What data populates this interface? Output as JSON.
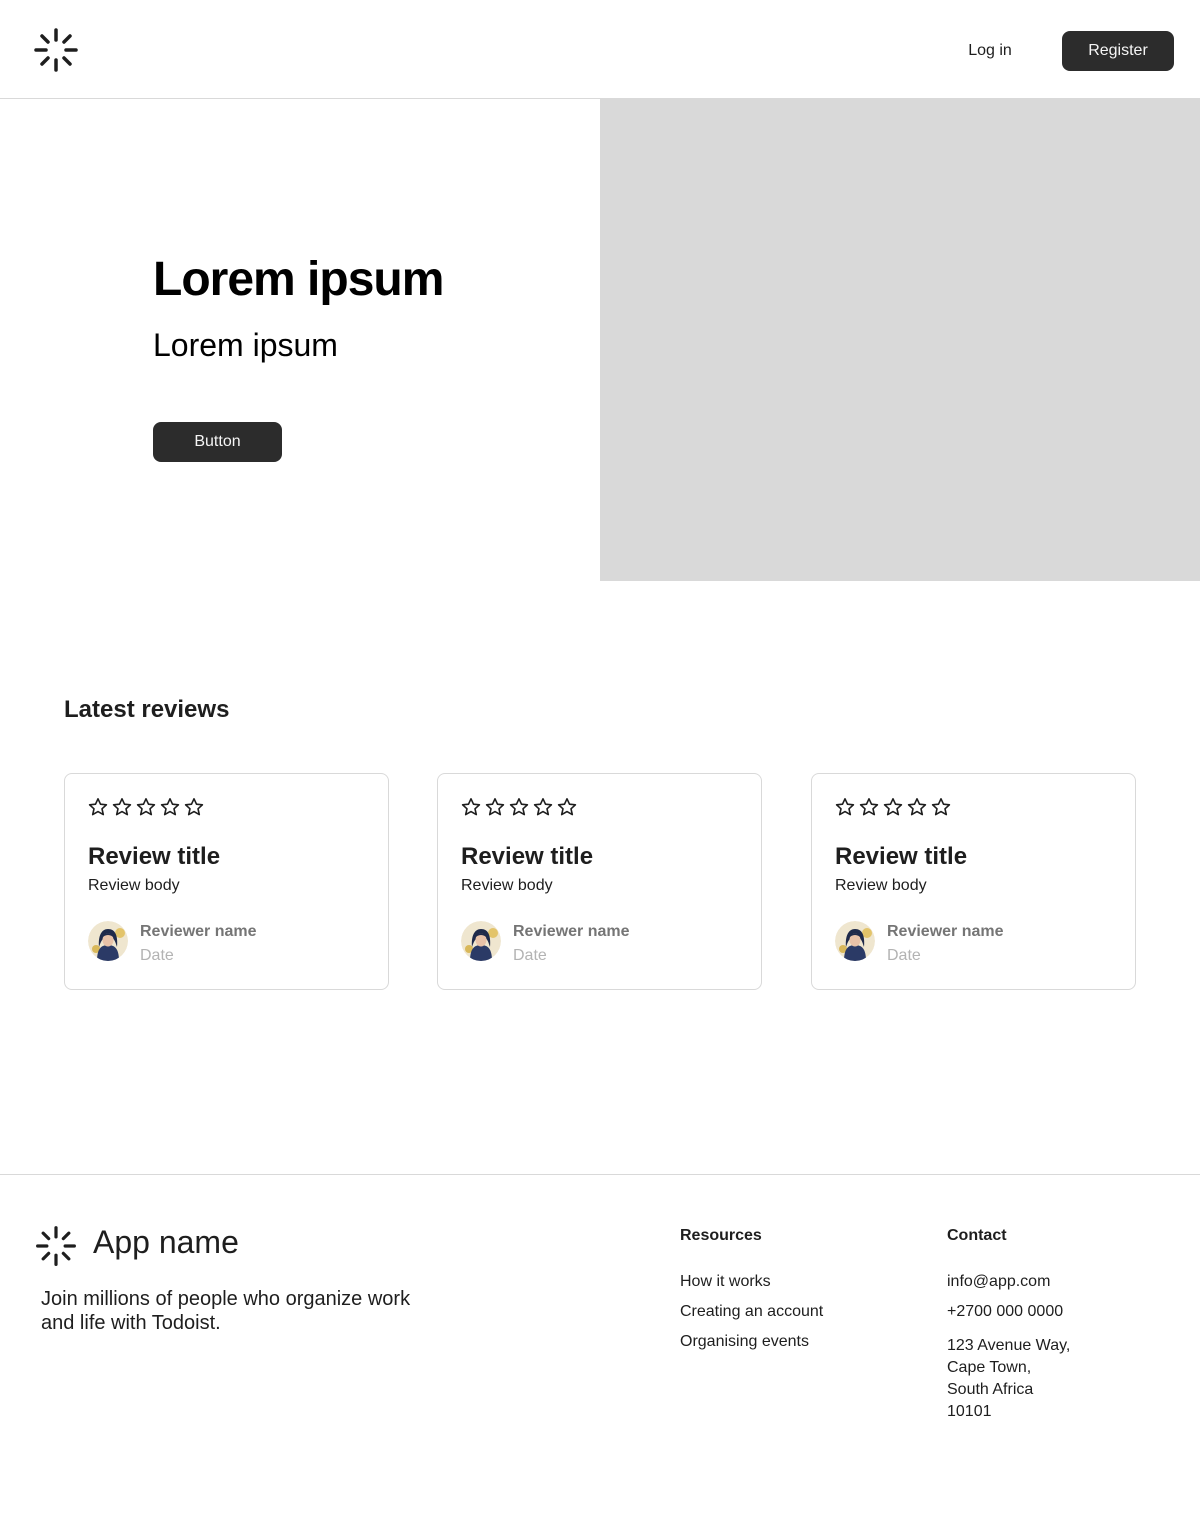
{
  "header": {
    "logo_icon": "spinner-burst-icon",
    "login_label": "Log in",
    "register_label": "Register"
  },
  "hero": {
    "title": "Lorem ipsum",
    "subtitle": "Lorem ipsum",
    "button_label": "Button",
    "image_color": "#d9d9d9"
  },
  "reviews": {
    "heading": "Latest reviews",
    "items": [
      {
        "rating": 0,
        "max_rating": 5,
        "title": "Review title",
        "body": "Review body",
        "reviewer_name": "Reviewer name",
        "date": "Date"
      },
      {
        "rating": 0,
        "max_rating": 5,
        "title": "Review title",
        "body": "Review body",
        "reviewer_name": "Reviewer name",
        "date": "Date"
      },
      {
        "rating": 0,
        "max_rating": 5,
        "title": "Review title",
        "body": "Review body",
        "reviewer_name": "Reviewer name",
        "date": "Date"
      }
    ]
  },
  "footer": {
    "app_name": "App name",
    "tagline": "Join millions of people who organize work and life with Todoist.",
    "resources": {
      "title": "Resources",
      "links": [
        "How it works",
        "Creating an account",
        "Organising events"
      ]
    },
    "contact": {
      "title": "Contact",
      "email": "info@app.com",
      "phone": "+2700 000 0000",
      "address_lines": [
        "123 Avenue Way,",
        "Cape Town,",
        "South Africa",
        "10101"
      ]
    }
  },
  "colors": {
    "primary_button": "#2c2c2c",
    "button_text": "#f5f5f5",
    "border": "#d9d9d9",
    "muted_text": "#757575",
    "faint_text": "#b3b3b3"
  }
}
